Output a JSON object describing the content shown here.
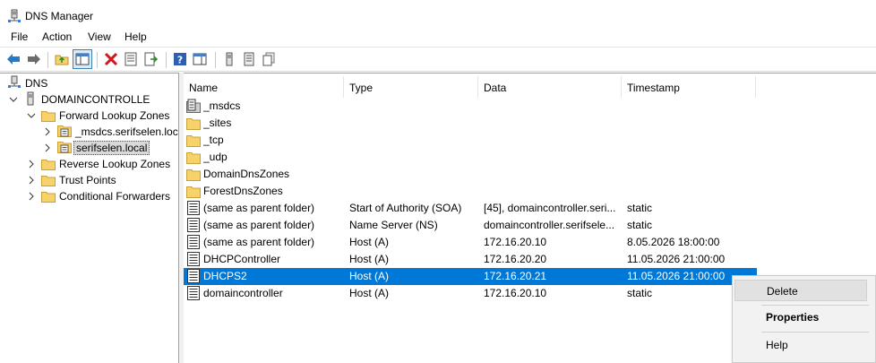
{
  "window": {
    "title": "DNS Manager",
    "icon": "dns-manager-icon"
  },
  "menubar": {
    "items": [
      "File",
      "Action",
      "View",
      "Help"
    ]
  },
  "toolbar": {
    "buttons": [
      "back-arrow-icon",
      "forward-arrow-icon",
      "up-folder-icon",
      "show-hide-tree-icon",
      "delete-icon",
      "properties-icon",
      "export-list-icon",
      "help-icon",
      "show-hide-action-pane-icon",
      "server-icon",
      "list-view-icon",
      "copy-icon"
    ]
  },
  "tree": {
    "root": "DNS",
    "server": "DOMAINCONTROLLE",
    "forward": "Forward Lookup Zones",
    "zone1": "_msdcs.serifselen.loc",
    "zone2": "serifselen.local",
    "reverse": "Reverse Lookup Zones",
    "trust": "Trust Points",
    "conditional": "Conditional Forwarders"
  },
  "list": {
    "columns": [
      "Name",
      "Type",
      "Data",
      "Timestamp"
    ],
    "rows": [
      {
        "name": "_msdcs",
        "type": "",
        "data": "",
        "timestamp": "",
        "icon": "zone-delegation-icon"
      },
      {
        "name": "_sites",
        "type": "",
        "data": "",
        "timestamp": "",
        "icon": "folder-icon"
      },
      {
        "name": "_tcp",
        "type": "",
        "data": "",
        "timestamp": "",
        "icon": "folder-icon"
      },
      {
        "name": "_udp",
        "type": "",
        "data": "",
        "timestamp": "",
        "icon": "folder-icon"
      },
      {
        "name": "DomainDnsZones",
        "type": "",
        "data": "",
        "timestamp": "",
        "icon": "folder-icon"
      },
      {
        "name": "ForestDnsZones",
        "type": "",
        "data": "",
        "timestamp": "",
        "icon": "folder-icon"
      },
      {
        "name": "(same as parent folder)",
        "type": "Start of Authority (SOA)",
        "data": "[45], domaincontroller.seri...",
        "timestamp": "static",
        "icon": "record-icon"
      },
      {
        "name": "(same as parent folder)",
        "type": "Name Server (NS)",
        "data": "domaincontroller.serifsele...",
        "timestamp": "static",
        "icon": "record-icon"
      },
      {
        "name": "(same as parent folder)",
        "type": "Host (A)",
        "data": "172.16.20.10",
        "timestamp": "8.05.2026 18:00:00",
        "icon": "record-icon"
      },
      {
        "name": "DHCPController",
        "type": "Host (A)",
        "data": "172.16.20.20",
        "timestamp": "11.05.2026 21:00:00",
        "icon": "record-icon"
      },
      {
        "name": "DHCPS2",
        "type": "Host (A)",
        "data": "172.16.20.21",
        "timestamp": "11.05.2026 21:00:00",
        "icon": "record-icon",
        "selected": true
      },
      {
        "name": "domaincontroller",
        "type": "Host (A)",
        "data": "172.16.20.10",
        "timestamp": "static",
        "icon": "record-icon"
      }
    ]
  },
  "context_menu": {
    "items": [
      {
        "label": "Delete",
        "hover": true
      },
      {
        "label": "Properties",
        "bold": true
      },
      {
        "label": "Help"
      }
    ]
  },
  "colors": {
    "selection": "#0078d7",
    "folder": "#f7d26b"
  }
}
